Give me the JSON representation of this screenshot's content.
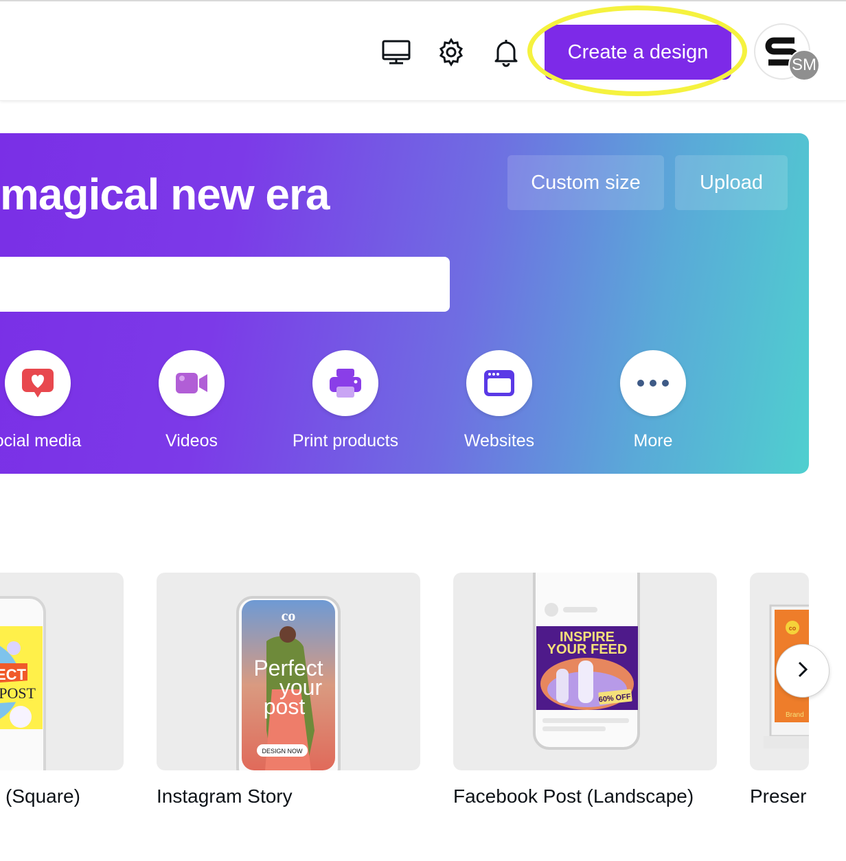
{
  "header": {
    "create_label": "Create a design",
    "avatar_initials": "SM",
    "icons": [
      "desktop-icon",
      "gear-icon",
      "bell-icon"
    ]
  },
  "banner": {
    "title": "magical new era",
    "custom_size_label": "Custom size",
    "upload_label": "Upload",
    "categories": [
      {
        "label": "ocial media",
        "icon": "heart-chat-icon",
        "color": "#e8484e"
      },
      {
        "label": "Videos",
        "icon": "video-camera-icon",
        "color": "#b15ed6"
      },
      {
        "label": "Print products",
        "icon": "printer-icon",
        "color": "#8a3ee8"
      },
      {
        "label": "Websites",
        "icon": "browser-window-icon",
        "color": "#5a39e6"
      },
      {
        "label": "More",
        "icon": "more-dots-icon",
        "color": "#3e5a86"
      }
    ]
  },
  "templates": [
    {
      "label": "(Square)",
      "art_text": [
        "ECT",
        "POST"
      ]
    },
    {
      "label": "Instagram Story",
      "art_text": [
        "Perfect",
        "your",
        "post",
        "DESIGN NOW"
      ]
    },
    {
      "label": "Facebook Post (Landscape)",
      "art_text": [
        "INSPIRE",
        "YOUR FEED",
        "60% OFF"
      ]
    },
    {
      "label": "Preser",
      "art_text": [
        "Brand"
      ]
    }
  ],
  "colors": {
    "brand": "#7d2ae8",
    "highlight": "#f5f23f"
  }
}
